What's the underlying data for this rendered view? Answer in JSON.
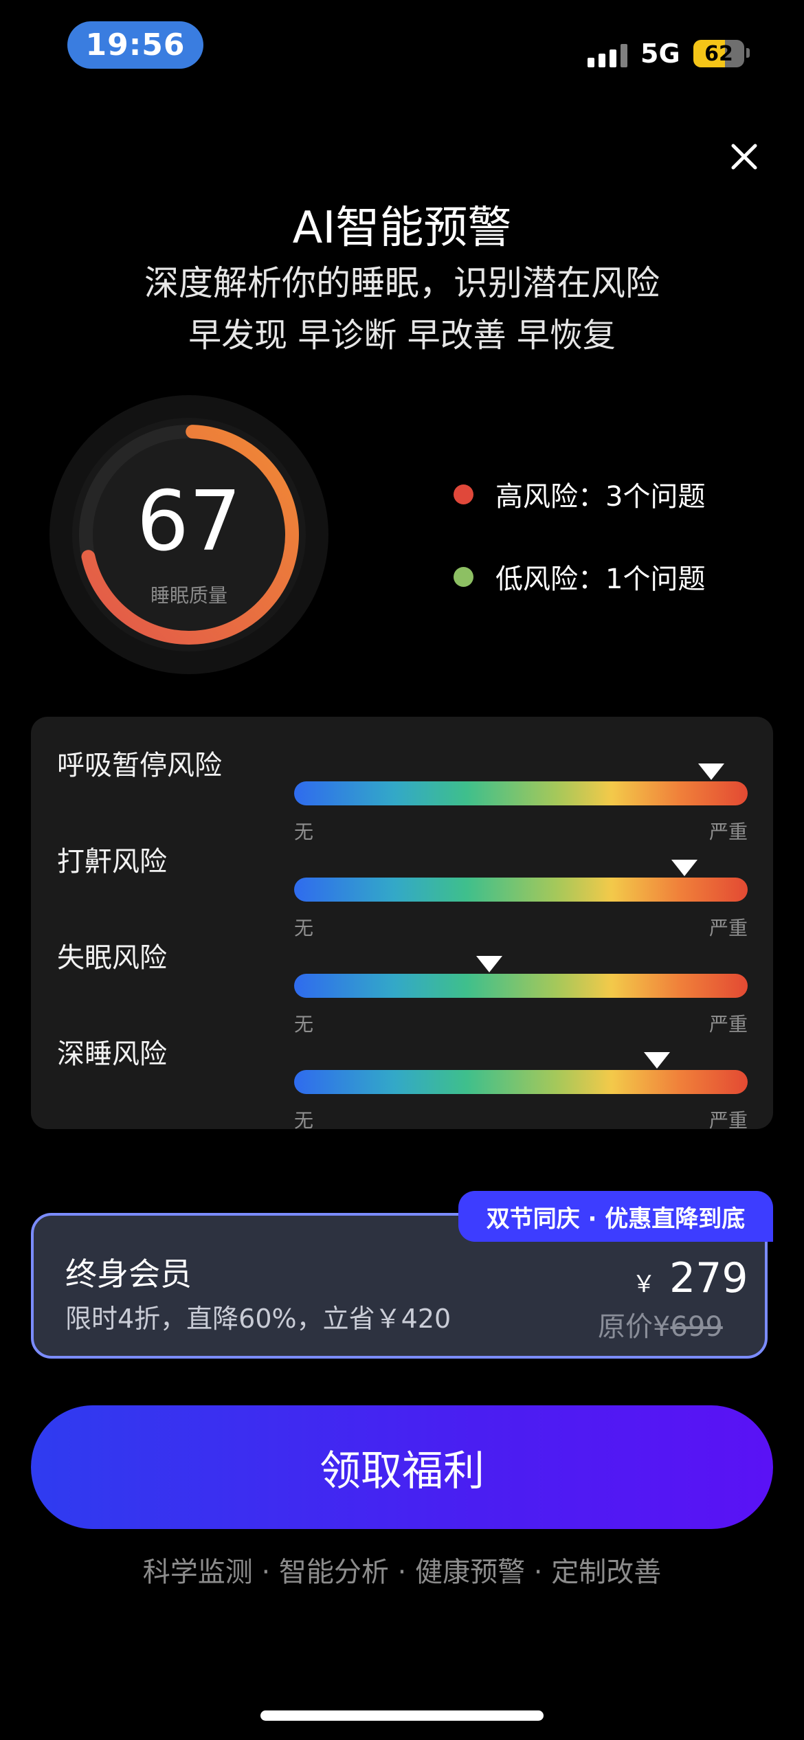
{
  "status_bar": {
    "time": "19:56",
    "network": "5G",
    "battery": "62"
  },
  "header": {
    "title": "AI智能预警",
    "subtitle": "深度解析你的睡眠，识别潜在风险",
    "tagline": "早发现 早诊断 早改善 早恢复"
  },
  "score": {
    "value": "67",
    "label": "睡眠质量",
    "fraction": 0.67
  },
  "risk_summary": [
    {
      "label": "高风险：3个问题",
      "color": "#e0483a"
    },
    {
      "label": "低风险：1个问题",
      "color": "#8dc063"
    }
  ],
  "risks": [
    {
      "label": "呼吸暂停风险",
      "level": 0.92,
      "min": "无",
      "max": "严重"
    },
    {
      "label": "打鼾风险",
      "level": 0.86,
      "min": "无",
      "max": "严重"
    },
    {
      "label": "失眠风险",
      "level": 0.43,
      "min": "无",
      "max": "严重"
    },
    {
      "label": "深睡风险",
      "level": 0.8,
      "min": "无",
      "max": "严重"
    }
  ],
  "offer": {
    "promo_tag": "双节同庆 · 优惠直降到底",
    "title": "终身会员",
    "description": "限时4折，直降60%，立省￥420",
    "currency": "￥",
    "price": "279",
    "original_label": "原价¥",
    "original_price": "699"
  },
  "cta": {
    "label": "领取福利"
  },
  "features": "科学监测 · 智能分析 · 健康预警 · 定制改善",
  "colors": {
    "accent": "#3d3dff",
    "gauge_start": "#e2584a",
    "gauge_end": "#f08a35"
  }
}
